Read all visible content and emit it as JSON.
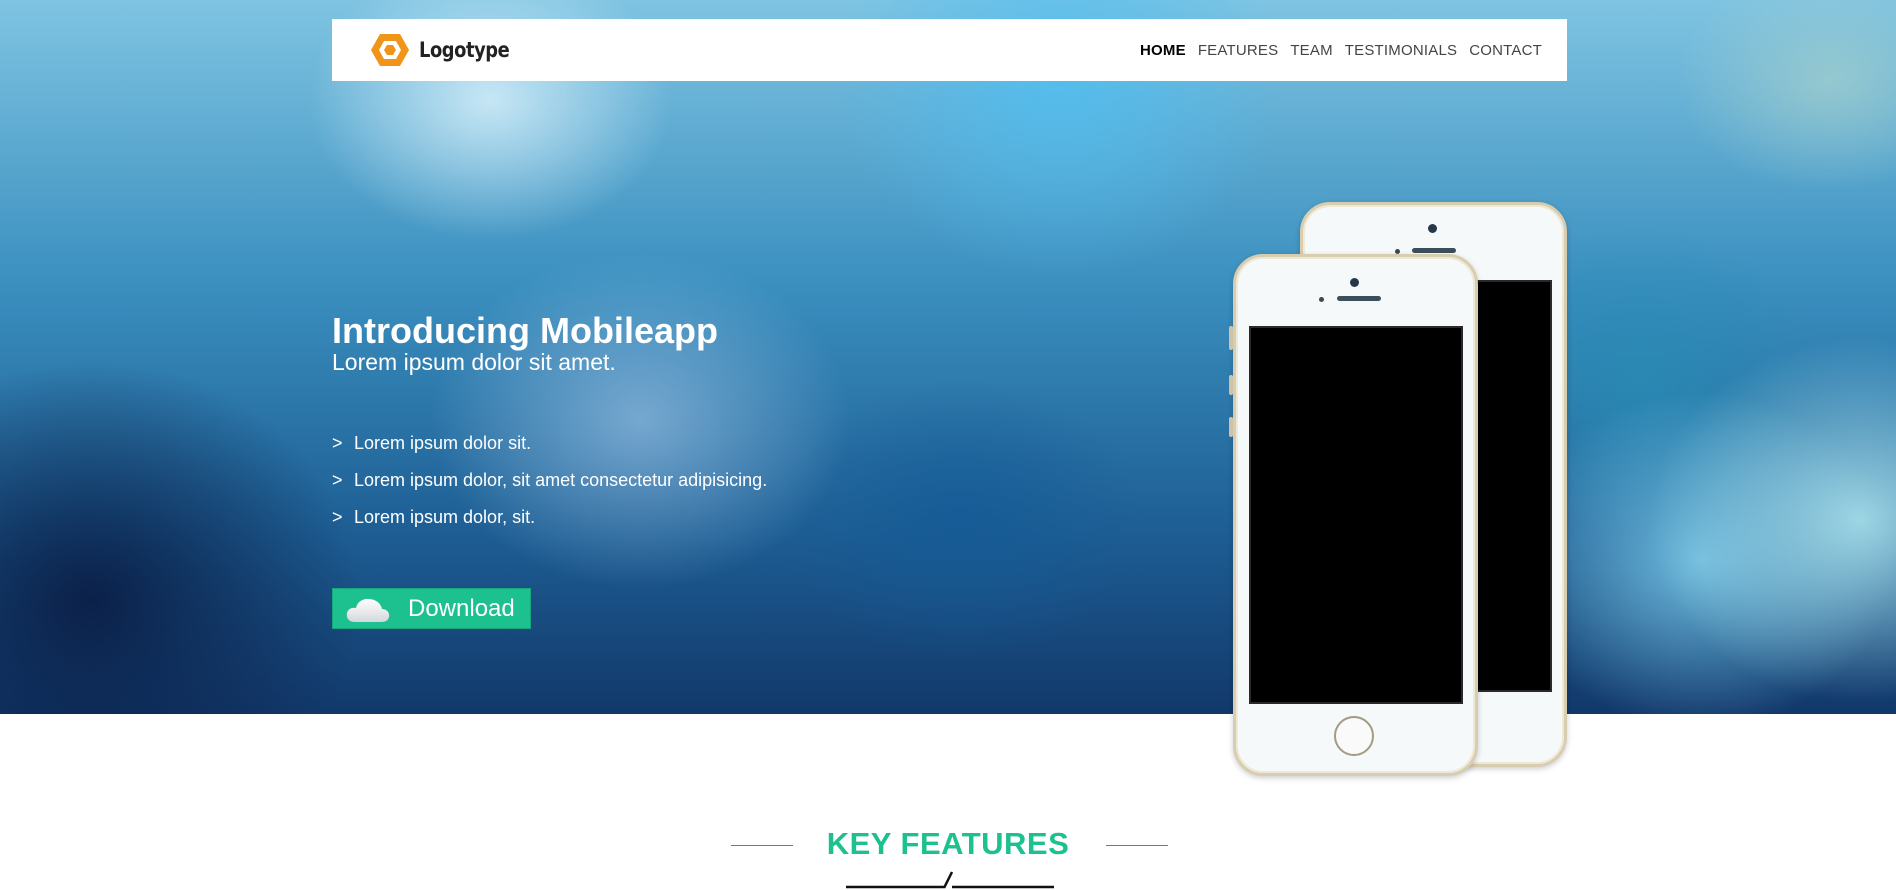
{
  "brand": {
    "name": "Logotype",
    "logo_color": "#f0941a"
  },
  "nav": {
    "items": [
      {
        "label": "HOME",
        "active": true
      },
      {
        "label": "FEATURES",
        "active": false
      },
      {
        "label": "TEAM",
        "active": false
      },
      {
        "label": "TESTIMONIALS",
        "active": false
      },
      {
        "label": "CONTACT",
        "active": false
      }
    ]
  },
  "hero": {
    "headline": "Introducing Mobileapp",
    "subheadline": "Lorem ipsum dolor sit amet.",
    "bullet_marker": ">",
    "bullets": [
      "Lorem ipsum dolor sit.",
      "Lorem ipsum dolor, sit amet consectetur adipisicing.",
      "Lorem ipsum dolor, sit."
    ],
    "download_label": "Download",
    "download_icon": "cloud-icon",
    "accent_color": "#1dc08f"
  },
  "features": {
    "title": "KEY FEATURES"
  }
}
